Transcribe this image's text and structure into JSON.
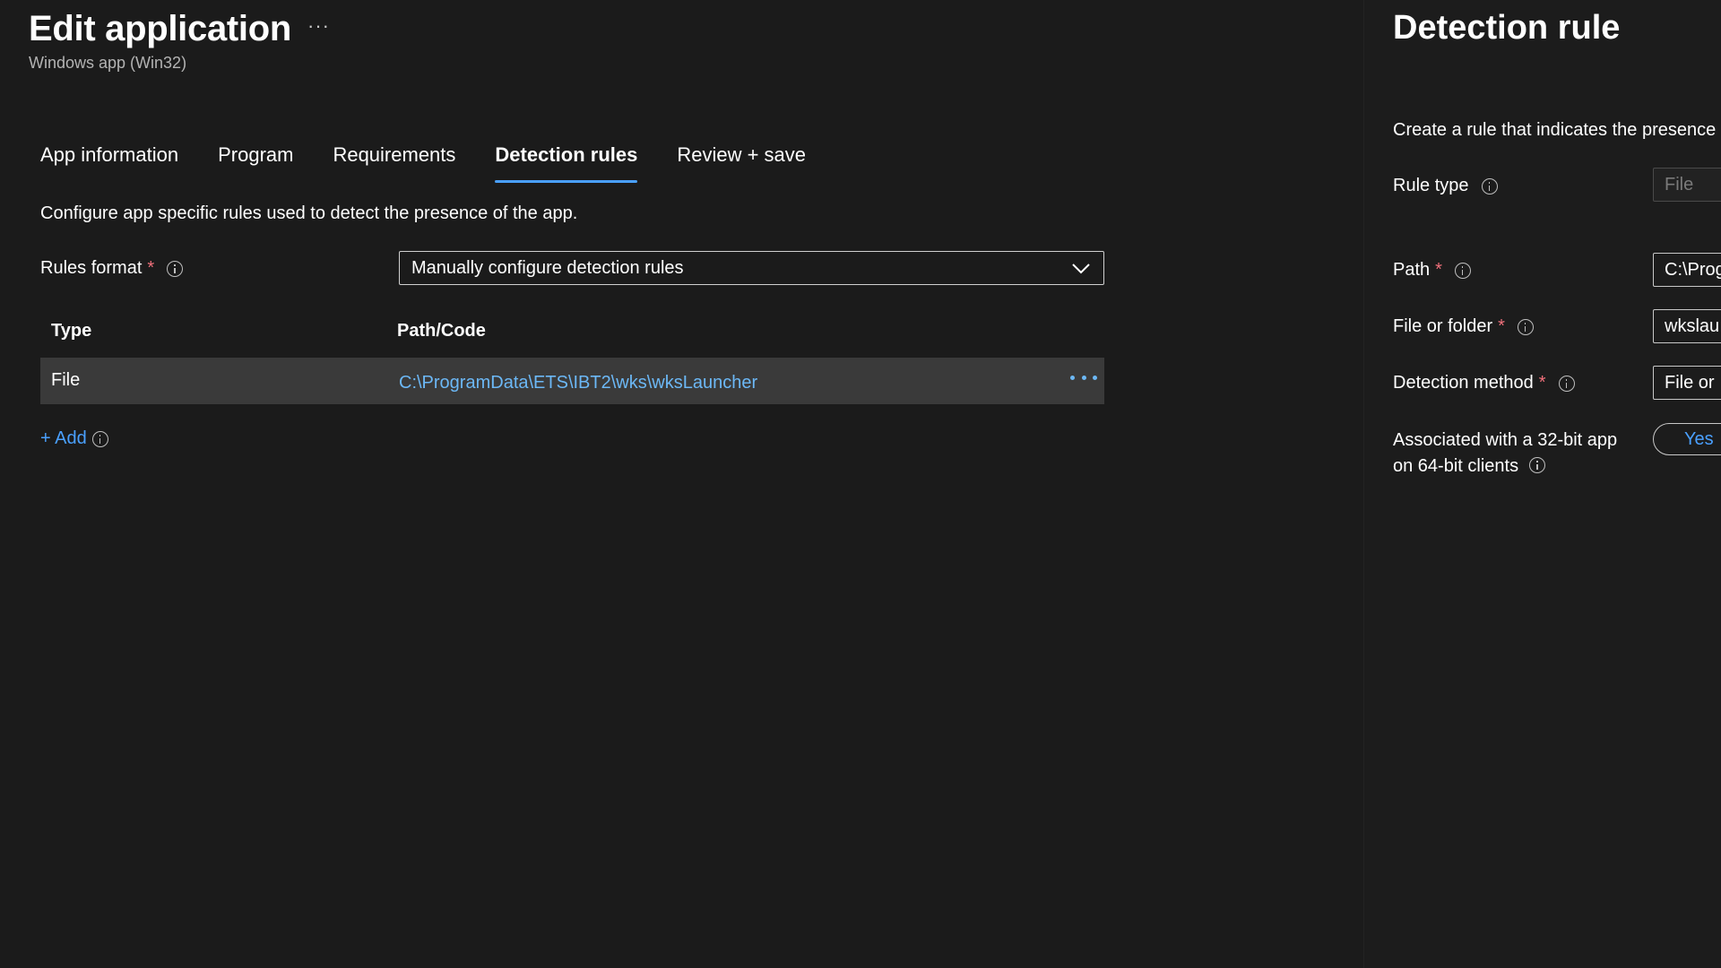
{
  "header": {
    "title": "Edit application",
    "more": "···",
    "subtitle": "Windows app (Win32)"
  },
  "tabs": [
    {
      "label": "App information",
      "active": false
    },
    {
      "label": "Program",
      "active": false
    },
    {
      "label": "Requirements",
      "active": false
    },
    {
      "label": "Detection rules",
      "active": true
    },
    {
      "label": "Review + save",
      "active": false
    }
  ],
  "detection": {
    "description": "Configure app specific rules used to detect the presence of the app.",
    "rules_format_label": "Rules format",
    "required_mark": "*",
    "rules_format_value": "Manually configure detection rules",
    "table": {
      "headers": [
        "Type",
        "Path/Code"
      ],
      "rows": [
        {
          "type": "File",
          "path": "C:\\ProgramData\\ETS\\IBT2\\wks\\wksLauncher"
        }
      ]
    },
    "add_label": "+ Add"
  },
  "panel": {
    "title": "Detection rule",
    "description": "Create a rule that indicates the presence",
    "rule_type_label": "Rule type",
    "rule_type_value": "File",
    "path_label": "Path",
    "path_value": "C:\\Prog",
    "file_label": "File or folder",
    "file_value": "wkslau",
    "method_label": "Detection method",
    "method_value": "File or",
    "assoc_label_line1": "Associated with a 32-bit app",
    "assoc_label_line2": "on 64-bit clients",
    "toggle_value": "Yes"
  },
  "colors": {
    "background": "#1b1b1b",
    "accent": "#4aa0ff",
    "link": "#6cb8f6",
    "required": "#f1707b",
    "row_selected": "#3a3a3a"
  }
}
